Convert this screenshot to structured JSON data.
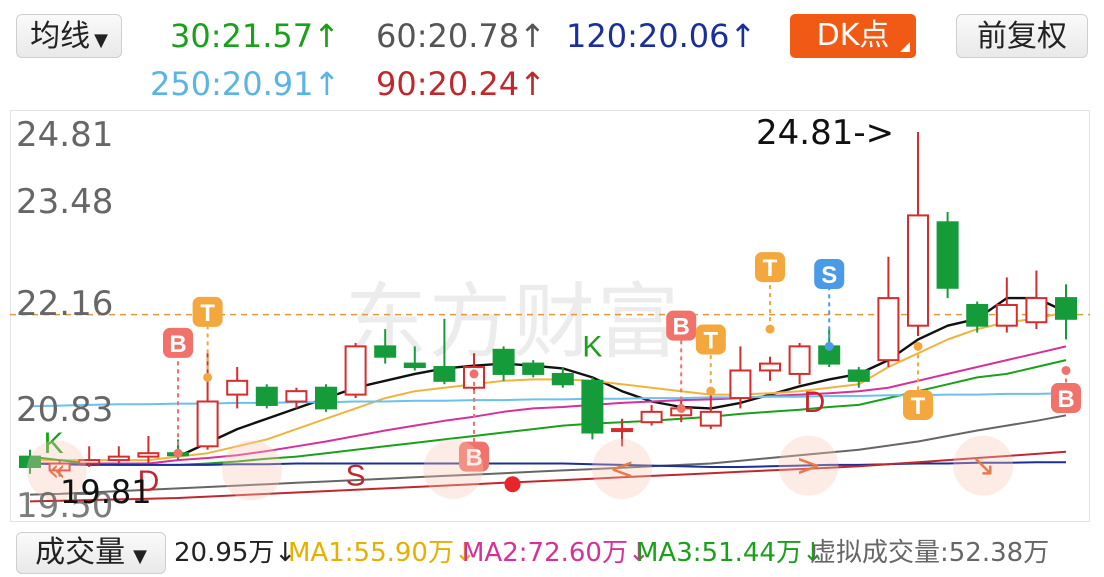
{
  "header": {
    "selector_label": "均线",
    "ma": [
      {
        "text": "30:21.57↑",
        "color": "#1aa01a"
      },
      {
        "text": "60:20.78↑",
        "color": "#555555"
      },
      {
        "text": "120:20.06↑",
        "color": "#1a2f9a"
      },
      {
        "text": "250:20.91↑",
        "color": "#5ab4e6"
      },
      {
        "text": "90:20.24↑",
        "color": "#c0282d"
      }
    ],
    "dk_label": "DK点",
    "adjust_label": "前复权"
  },
  "watermark": "东方财富",
  "chart_data": {
    "type": "candlestick",
    "y_ticks": [
      "24.81",
      "23.48",
      "22.16",
      "20.83",
      "19.50"
    ],
    "ylim": [
      19.5,
      24.81
    ],
    "reference_line": 22.16,
    "max_label": "24.81->",
    "min_label": "19.81",
    "candles": [
      {
        "o": 20.1,
        "c": 19.95,
        "h": 20.2,
        "l": 19.85
      },
      {
        "o": 19.9,
        "c": 20.0,
        "h": 20.05,
        "l": 19.81
      },
      {
        "o": 20.0,
        "c": 20.05,
        "h": 20.25,
        "l": 19.95
      },
      {
        "o": 20.05,
        "c": 20.1,
        "h": 20.25,
        "l": 20.0
      },
      {
        "o": 20.1,
        "c": 20.15,
        "h": 20.4,
        "l": 20.0
      },
      {
        "o": 20.15,
        "c": 20.12,
        "h": 20.35,
        "l": 20.05
      },
      {
        "o": 20.25,
        "c": 20.9,
        "h": 21.6,
        "l": 20.2
      },
      {
        "o": 21.0,
        "c": 21.2,
        "h": 21.4,
        "l": 20.8
      },
      {
        "o": 21.1,
        "c": 20.85,
        "h": 21.15,
        "l": 20.8
      },
      {
        "o": 20.9,
        "c": 21.05,
        "h": 21.1,
        "l": 20.8
      },
      {
        "o": 21.1,
        "c": 20.8,
        "h": 21.15,
        "l": 20.75
      },
      {
        "o": 21.0,
        "c": 21.7,
        "h": 21.75,
        "l": 20.95
      },
      {
        "o": 21.7,
        "c": 21.55,
        "h": 21.95,
        "l": 21.45
      },
      {
        "o": 21.45,
        "c": 21.4,
        "h": 21.7,
        "l": 21.35
      },
      {
        "o": 21.4,
        "c": 21.2,
        "h": 22.1,
        "l": 21.15
      },
      {
        "o": 21.1,
        "c": 21.4,
        "h": 21.6,
        "l": 21.05
      },
      {
        "o": 21.65,
        "c": 21.3,
        "h": 21.7,
        "l": 21.2
      },
      {
        "o": 21.45,
        "c": 21.3,
        "h": 21.5,
        "l": 21.25
      },
      {
        "o": 21.3,
        "c": 21.15,
        "h": 21.4,
        "l": 21.1
      },
      {
        "o": 21.2,
        "c": 20.45,
        "h": 21.25,
        "l": 20.35
      },
      {
        "o": 20.5,
        "c": 20.5,
        "h": 20.65,
        "l": 20.25
      },
      {
        "o": 20.6,
        "c": 20.75,
        "h": 20.85,
        "l": 20.55
      },
      {
        "o": 20.7,
        "c": 20.8,
        "h": 20.95,
        "l": 20.6
      },
      {
        "o": 20.55,
        "c": 20.75,
        "h": 21.05,
        "l": 20.5
      },
      {
        "o": 20.95,
        "c": 21.35,
        "h": 21.7,
        "l": 20.8
      },
      {
        "o": 21.35,
        "c": 21.45,
        "h": 21.55,
        "l": 21.2
      },
      {
        "o": 21.3,
        "c": 21.7,
        "h": 21.75,
        "l": 21.15
      },
      {
        "o": 21.7,
        "c": 21.45,
        "h": 21.95,
        "l": 21.4
      },
      {
        "o": 21.35,
        "c": 21.2,
        "h": 21.4,
        "l": 21.1
      },
      {
        "o": 21.5,
        "c": 22.4,
        "h": 23.0,
        "l": 21.4
      },
      {
        "o": 22.0,
        "c": 23.6,
        "h": 24.81,
        "l": 21.85
      },
      {
        "o": 23.5,
        "c": 22.55,
        "h": 23.65,
        "l": 22.4
      },
      {
        "o": 22.3,
        "c": 22.0,
        "h": 22.35,
        "l": 21.9
      },
      {
        "o": 22.0,
        "c": 22.3,
        "h": 22.7,
        "l": 21.9
      },
      {
        "o": 22.05,
        "c": 22.4,
        "h": 22.8,
        "l": 21.95
      },
      {
        "o": 22.4,
        "c": 22.1,
        "h": 22.6,
        "l": 21.8
      }
    ],
    "ma_lines": [
      {
        "color": "#111111",
        "width": 2.4,
        "values": [
          null,
          null,
          null,
          null,
          null,
          20.1,
          20.3,
          20.5,
          20.65,
          20.8,
          20.95,
          21.1,
          21.2,
          21.3,
          21.38,
          21.42,
          21.45,
          21.42,
          21.38,
          21.25,
          21.05,
          20.9,
          20.82,
          20.8,
          20.88,
          21.0,
          21.12,
          21.22,
          21.3,
          21.5,
          21.8,
          22.0,
          22.1,
          22.4,
          22.4,
          22.2
        ]
      },
      {
        "color": "#f0b43c",
        "width": 2,
        "values": [
          20.05,
          20.05,
          20.05,
          20.05,
          20.05,
          20.1,
          20.15,
          20.25,
          20.35,
          20.5,
          20.65,
          20.8,
          20.95,
          21.05,
          21.1,
          21.15,
          21.2,
          21.22,
          21.22,
          21.2,
          21.15,
          21.1,
          21.05,
          21.0,
          21.0,
          21.02,
          21.05,
          21.1,
          21.15,
          21.4,
          21.6,
          21.8,
          21.95,
          22.05,
          22.1,
          22.2
        ]
      },
      {
        "color": "#d6309a",
        "width": 2,
        "values": [
          20.0,
          20.0,
          20.0,
          20.0,
          20.0,
          20.05,
          20.08,
          20.12,
          20.18,
          20.25,
          20.32,
          20.4,
          20.48,
          20.55,
          20.62,
          20.68,
          20.75,
          20.8,
          20.82,
          20.85,
          20.88,
          20.9,
          20.92,
          20.93,
          20.95,
          20.98,
          21.0,
          21.02,
          21.05,
          21.1,
          21.2,
          21.3,
          21.4,
          21.5,
          21.6,
          21.7
        ]
      },
      {
        "color": "#1aa01a",
        "width": 2,
        "values": [
          20.1,
          20.05,
          20.0,
          19.98,
          19.98,
          19.98,
          20.0,
          20.03,
          20.07,
          20.1,
          20.15,
          20.2,
          20.25,
          20.3,
          20.35,
          20.4,
          20.45,
          20.5,
          20.55,
          20.58,
          20.6,
          20.62,
          20.65,
          20.68,
          20.72,
          20.75,
          20.78,
          20.82,
          20.85,
          20.95,
          21.05,
          21.15,
          21.25,
          21.3,
          21.4,
          21.5
        ]
      },
      {
        "color": "#666666",
        "width": 2,
        "values": [
          19.55,
          19.56,
          19.58,
          19.6,
          19.62,
          19.64,
          19.66,
          19.68,
          19.7,
          19.72,
          19.74,
          19.76,
          19.78,
          19.8,
          19.82,
          19.84,
          19.86,
          19.88,
          19.9,
          19.92,
          19.94,
          19.96,
          19.98,
          20.0,
          20.04,
          20.08,
          20.12,
          20.16,
          20.2,
          20.26,
          20.32,
          20.4,
          20.48,
          20.55,
          20.62,
          20.7
        ]
      },
      {
        "color": "#1a2f9a",
        "width": 2,
        "values": [
          20.0,
          19.99,
          19.98,
          19.98,
          19.98,
          19.98,
          19.98,
          19.99,
          19.99,
          20.0,
          20.0,
          20.0,
          20.0,
          20.0,
          20.0,
          20.0,
          20.0,
          20.0,
          20.0,
          19.99,
          19.98,
          19.97,
          19.96,
          19.95,
          19.95,
          19.96,
          19.97,
          19.98,
          19.98,
          19.99,
          20.0,
          20.0,
          20.01,
          20.01,
          20.02,
          20.02
        ]
      },
      {
        "color": "#c0282d",
        "width": 2,
        "values": [
          19.45,
          19.46,
          19.47,
          19.48,
          19.49,
          19.5,
          19.52,
          19.54,
          19.56,
          19.58,
          19.6,
          19.62,
          19.64,
          19.66,
          19.68,
          19.7,
          19.72,
          19.74,
          19.76,
          19.78,
          19.8,
          19.82,
          19.84,
          19.86,
          19.88,
          19.9,
          19.92,
          19.94,
          19.96,
          19.99,
          20.02,
          20.05,
          20.08,
          20.11,
          20.14,
          20.17
        ]
      },
      {
        "color": "#6cc0ec",
        "width": 2,
        "values": [
          20.83,
          20.84,
          20.85,
          20.86,
          20.86,
          20.87,
          20.87,
          20.88,
          20.88,
          20.89,
          20.89,
          20.9,
          20.9,
          20.91,
          20.91,
          20.92,
          20.92,
          20.93,
          20.93,
          20.94,
          20.94,
          20.95,
          20.95,
          20.96,
          20.96,
          20.97,
          20.97,
          20.98,
          20.98,
          20.99,
          20.99,
          21.0,
          21.0,
          21.01,
          21.01,
          21.02
        ]
      }
    ],
    "signals": [
      {
        "i": 5,
        "type": "B",
        "side": "top",
        "price": 20.15,
        "badge": 21.75
      },
      {
        "i": 6,
        "type": "T",
        "side": "top",
        "price": 21.25,
        "badge": 22.2
      },
      {
        "i": 15,
        "type": "B",
        "side": "bottom",
        "price": 21.3,
        "badge": 20.1
      },
      {
        "i": 22,
        "type": "B",
        "side": "top",
        "price": 20.8,
        "badge": 22.0
      },
      {
        "i": 23,
        "type": "T",
        "side": "top",
        "price": 21.05,
        "badge": 21.8
      },
      {
        "i": 25,
        "type": "T",
        "side": "top",
        "price": 21.95,
        "badge": 22.85
      },
      {
        "i": 27,
        "type": "S",
        "side": "top",
        "price": 21.7,
        "badge": 22.75
      },
      {
        "i": 30,
        "type": "T",
        "side": "bottom",
        "price": 21.7,
        "badge": 20.85
      },
      {
        "i": 35,
        "type": "B",
        "side": "bottom",
        "price": 21.35,
        "badge": 20.95
      }
    ],
    "letters": [
      {
        "i": 0.8,
        "text": "K",
        "color": "#1aa01a",
        "price": 20.15
      },
      {
        "i": 19,
        "text": "K",
        "color": "#1aa01a",
        "price": 21.55
      },
      {
        "i": 4,
        "text": "D",
        "color": "#c0282d",
        "price": 19.6
      },
      {
        "i": 26.5,
        "text": "D",
        "color": "#c0282d",
        "price": 20.75
      },
      {
        "i": 11,
        "text": "S",
        "color": "#c0282d",
        "price": 19.68
      }
    ]
  },
  "volume_bar": {
    "selector_label": "成交量",
    "values": [
      {
        "text": "20.95万↓",
        "color": "#222222"
      },
      {
        "text": "MA1:55.90万↓",
        "color": "#e6b000"
      },
      {
        "text": "MA2:72.60万↓",
        "color": "#d6309a"
      },
      {
        "text": "MA3:51.44万↓",
        "color": "#1aa01a"
      },
      {
        "text": "虚拟成交量:52.38万",
        "color": "#666666"
      }
    ]
  }
}
